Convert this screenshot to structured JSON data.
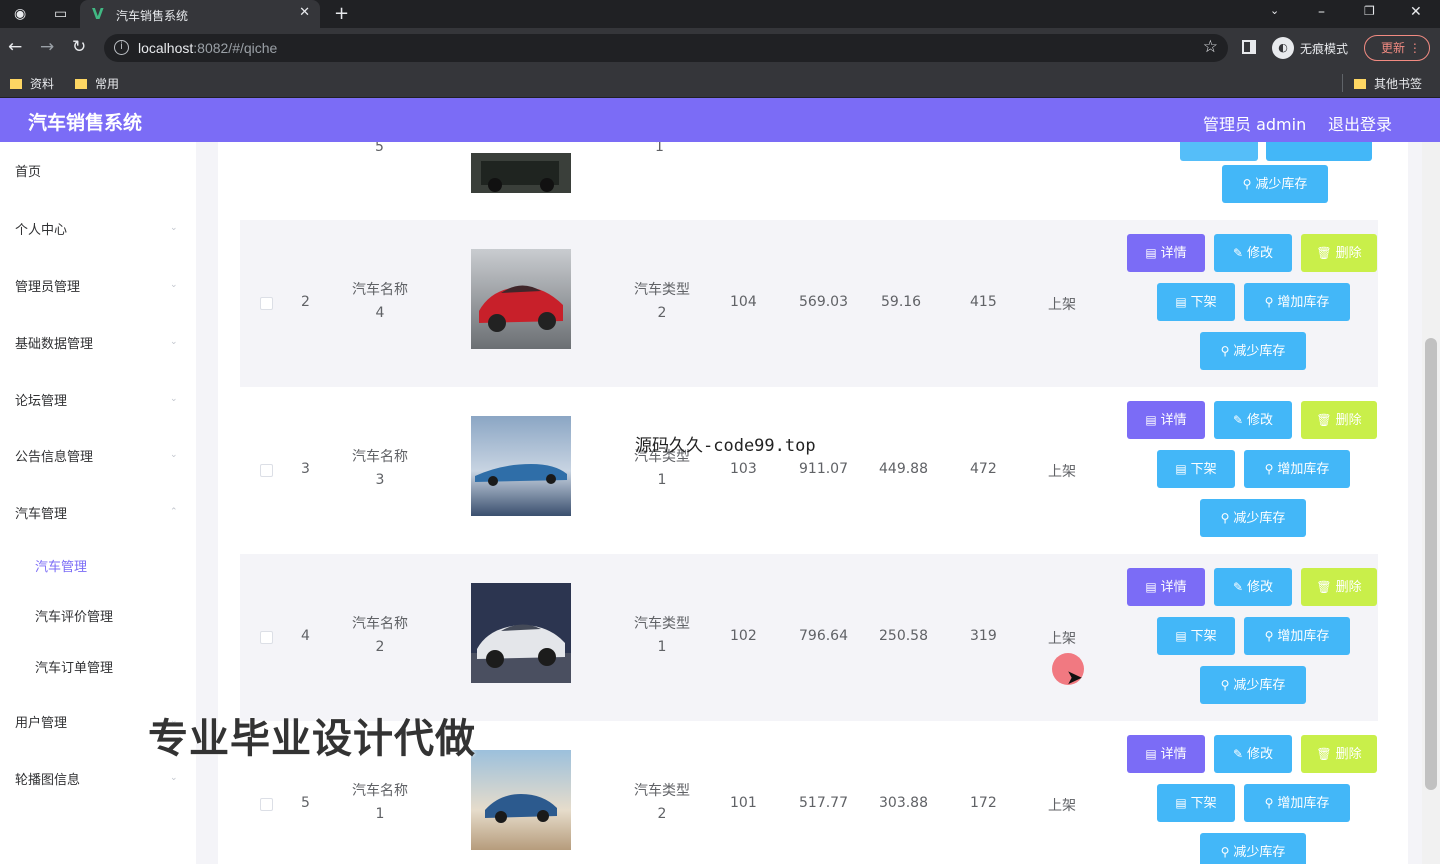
{
  "browser": {
    "tab_title": "汽车销售系统",
    "url_host": "localhost",
    "url_rest": ":8082/#/qiche",
    "incognito_label": "无痕模式",
    "update_label": "更新",
    "bookmarks": [
      "资料",
      "常用"
    ],
    "other_bookmarks": "其他书签"
  },
  "header": {
    "title": "汽车销售系统",
    "admin": "管理员 admin",
    "logout": "退出登录",
    "accent_color": "#7b6cf6"
  },
  "sidebar": {
    "items": [
      {
        "label": "首页"
      },
      {
        "label": "个人中心"
      },
      {
        "label": "管理员管理"
      },
      {
        "label": "基础数据管理"
      },
      {
        "label": "论坛管理"
      },
      {
        "label": "公告信息管理"
      },
      {
        "label": "汽车管理"
      },
      {
        "label": "汽车管理"
      },
      {
        "label": "汽车评价管理"
      },
      {
        "label": "汽车订单管理"
      },
      {
        "label": "用户管理"
      },
      {
        "label": "轮播图信息"
      }
    ]
  },
  "table": {
    "partial_top": {
      "index": "5",
      "type": "1",
      "stock_down_label": "减少库存"
    },
    "rows": [
      {
        "index": "2",
        "name_label": "汽车名称",
        "name": "4",
        "type_label": "汽车类型",
        "type": "2",
        "col1": "104",
        "col2": "569.03",
        "col3": "59.16",
        "col4": "415",
        "status": "上架",
        "image": "red-car"
      },
      {
        "index": "3",
        "name_label": "汽车名称",
        "name": "3",
        "type_label": "汽车类型",
        "type": "1",
        "col1": "103",
        "col2": "911.07",
        "col3": "449.88",
        "col4": "472",
        "status": "上架",
        "image": "blue-sports-car"
      },
      {
        "index": "4",
        "name_label": "汽车名称",
        "name": "2",
        "type_label": "汽车类型",
        "type": "1",
        "col1": "102",
        "col2": "796.64",
        "col3": "250.58",
        "col4": "319",
        "status": "上架",
        "image": "silver-sedan"
      },
      {
        "index": "5",
        "name_label": "汽车名称",
        "name": "1",
        "type_label": "汽车类型",
        "type": "2",
        "col1": "101",
        "col2": "517.77",
        "col3": "303.88",
        "col4": "172",
        "status": "上架",
        "image": "blue-coupe"
      }
    ],
    "buttons": {
      "detail": "详情",
      "edit": "修改",
      "delete": "删除",
      "offshelf": "下架",
      "stock_up": "增加库存",
      "stock_down": "减少库存"
    }
  },
  "overlays": {
    "source_text": "源码久久-code99.top",
    "ad_text": "专业毕业设计代做"
  }
}
